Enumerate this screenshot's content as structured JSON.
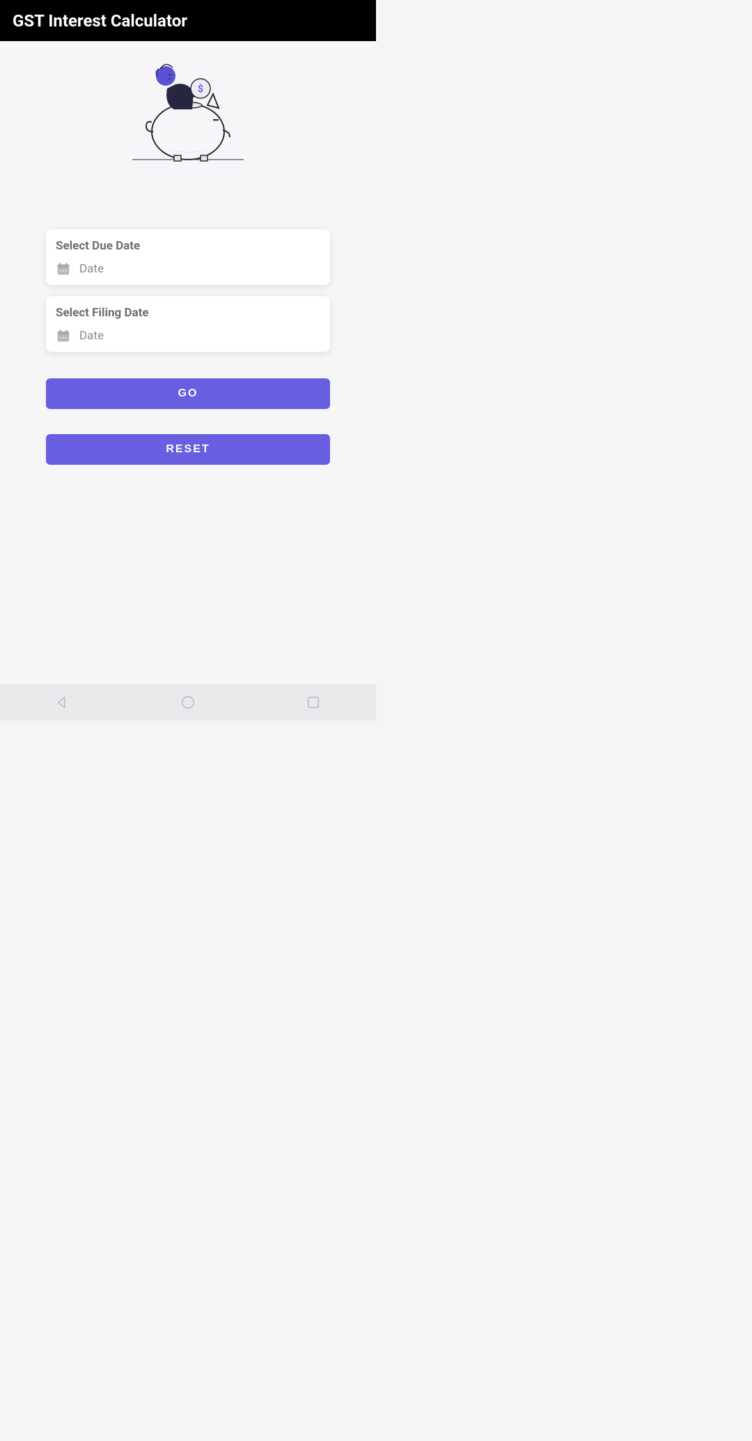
{
  "header": {
    "title": "GST Interest Calculator"
  },
  "cards": {
    "dueDate": {
      "title": "Select Due Date",
      "placeholder": "Date"
    },
    "filingDate": {
      "title": "Select Filing Date",
      "placeholder": "Date"
    }
  },
  "buttons": {
    "go": {
      "label": "GO"
    },
    "reset": {
      "label": "RESET"
    }
  },
  "colors": {
    "accent": "#685fe0",
    "appBar": "#000000",
    "cardBg": "#ffffff",
    "pageBg": "#f6f6f8",
    "textMuted": "#6e6e73"
  },
  "icons": {
    "calendar": "calendar-icon",
    "navBack": "nav-back-icon",
    "navHome": "nav-home-icon",
    "navRecent": "nav-recent-icon",
    "illustration": "piggy-bank-savings-illustration"
  }
}
